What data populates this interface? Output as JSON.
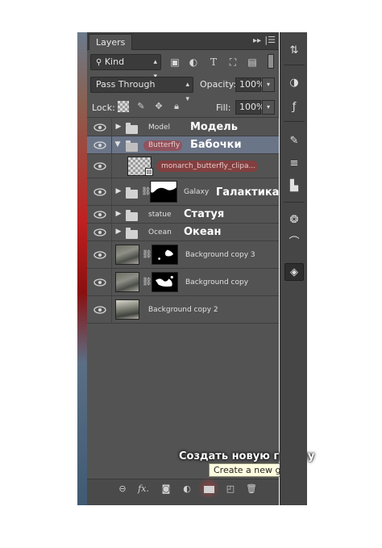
{
  "panel": {
    "tab_label": "Layers",
    "collapse_icon": "double-arrow-right-icon",
    "menu_icon": "panel-menu-icon"
  },
  "filter": {
    "kind_label": "Kind",
    "icons": [
      "image-filter-icon",
      "adjustment-filter-icon",
      "type-filter-icon",
      "shape-filter-icon",
      "smart-object-filter-icon"
    ]
  },
  "blend": {
    "mode": "Pass Through",
    "opacity_label": "Opacity:",
    "opacity_value": "100%",
    "fill_label": "Fill:",
    "fill_value": "100%"
  },
  "lock": {
    "label": "Lock:",
    "icons": [
      "lock-transparent-icon",
      "lock-image-icon",
      "lock-position-icon",
      "lock-all-icon"
    ]
  },
  "layers": [
    {
      "name": "Model",
      "annotation": "Модель",
      "kind": "group",
      "expanded": false,
      "selected": false
    },
    {
      "name": "Butterfly",
      "annotation": "Бабочки",
      "kind": "group",
      "expanded": true,
      "selected": true
    },
    {
      "name": "monarch_butterfly_clipa...",
      "annotation": "",
      "kind": "smart-object",
      "selected": false
    },
    {
      "name": "Galaxy",
      "annotation": "Галактика",
      "kind": "group-with-mask",
      "expanded": false,
      "selected": false
    },
    {
      "name": "statue",
      "annotation": "Статуя",
      "kind": "group",
      "expanded": false,
      "selected": false
    },
    {
      "name": "Ocean",
      "annotation": "Океан",
      "kind": "group",
      "expanded": false,
      "selected": false
    },
    {
      "name": "Background copy 3",
      "annotation": "",
      "kind": "layer-with-mask",
      "selected": false
    },
    {
      "name": "Background copy",
      "annotation": "",
      "kind": "layer-with-mask",
      "selected": false
    },
    {
      "name": "Background copy 2",
      "annotation": "",
      "kind": "layer",
      "selected": false
    }
  ],
  "bottom_bar": {
    "icons": [
      "link-layers-icon",
      "fx-icon",
      "add-mask-icon",
      "adjustment-layer-icon",
      "new-group-icon",
      "new-layer-icon",
      "delete-icon"
    ],
    "fx_label": "fx."
  },
  "tooltip": {
    "text": "Create a new group",
    "annotation": "Создать новую группу"
  },
  "dock": {
    "icons": [
      "history-icon",
      "color-icon",
      "styles-icon",
      "brush-icon",
      "adjustments-icon",
      "tool-presets-icon",
      "channels-icon",
      "paths-icon",
      "layers-icon"
    ]
  },
  "colors": {
    "panel_bg": "#535353",
    "selected_row": "#6b7588",
    "highlight": "#be2828",
    "tooltip_bg": "#fffde0"
  }
}
